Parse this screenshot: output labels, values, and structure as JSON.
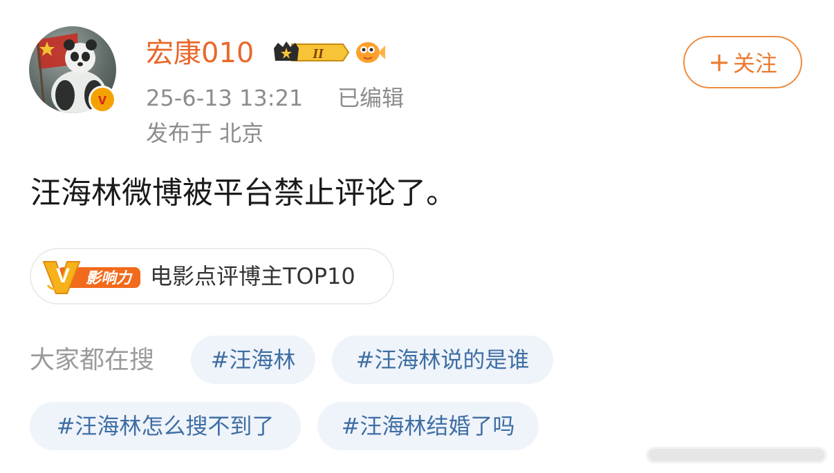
{
  "user": {
    "name": "宏康010",
    "level_badge": "II",
    "verified_mark": "v"
  },
  "post": {
    "time": "25-6-13 13:21",
    "edited": "已编辑",
    "location": "发布于 北京",
    "text": "汪海林微博被平台禁止评论了。"
  },
  "follow": {
    "plus": "+",
    "label": "关注"
  },
  "influence": {
    "badge_letter": "V",
    "badge_text": "影响力",
    "label": "电影点评博主TOP10"
  },
  "hot_search": {
    "label": "大家都在搜",
    "topics": [
      "#汪海林",
      "#汪海林说的是谁",
      "#汪海林怎么搜不到了",
      "#汪海林结婚了吗"
    ]
  },
  "colors": {
    "username": "#e8682a",
    "follow_border": "#ef8a3d",
    "topic_text": "#3e6ea3",
    "topic_bg": "#eff3fa",
    "meta_text": "#8c8c8c"
  }
}
